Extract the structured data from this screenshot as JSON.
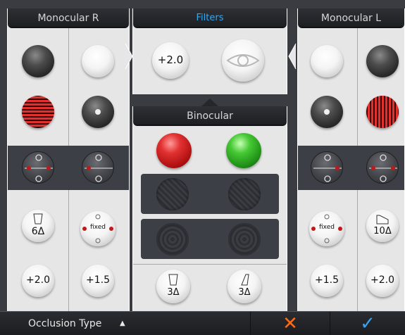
{
  "panels": {
    "monocular_r": {
      "title": "Monocular R"
    },
    "filters": {
      "title": "Filters",
      "power_label": "+2.0"
    },
    "binocular": {
      "title": "Binocular",
      "prism_left": "3Δ",
      "prism_right": "3Δ"
    },
    "monocular_l": {
      "title": "Monocular L"
    }
  },
  "right_eye": {
    "prism_label": "6Δ",
    "fixed_label": "fixed",
    "lens_outer": "+2.0",
    "lens_inner": "+1.5"
  },
  "left_eye": {
    "prism_label": "10Δ",
    "fixed_label": "fixed",
    "lens_inner": "+1.5",
    "lens_outer": "+2.0"
  },
  "footer": {
    "occlusion_label": "Occlusion Type",
    "dropdown_glyph": "▲",
    "cancel_glyph": "✕",
    "confirm_glyph": "✓"
  },
  "colors": {
    "accent_blue": "#35a7ee",
    "cancel_orange": "#ff6a12",
    "panel_bg": "#e6e6e6",
    "dark_row": "#3c3f46"
  }
}
